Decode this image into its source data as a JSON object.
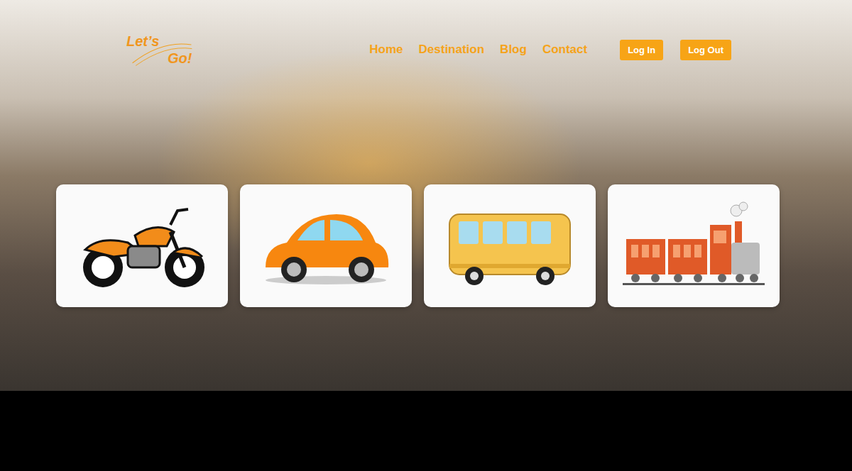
{
  "logo": {
    "line1": "Let’s",
    "line2": "Go!"
  },
  "nav": [
    {
      "label": "Home"
    },
    {
      "label": "Destination"
    },
    {
      "label": "Blog"
    },
    {
      "label": "Contact"
    }
  ],
  "buttons": [
    "Log In",
    "Log Out"
  ],
  "cards": [
    {
      "kind": "motorcycle"
    },
    {
      "kind": "car"
    },
    {
      "kind": "bus"
    },
    {
      "kind": "train"
    }
  ]
}
